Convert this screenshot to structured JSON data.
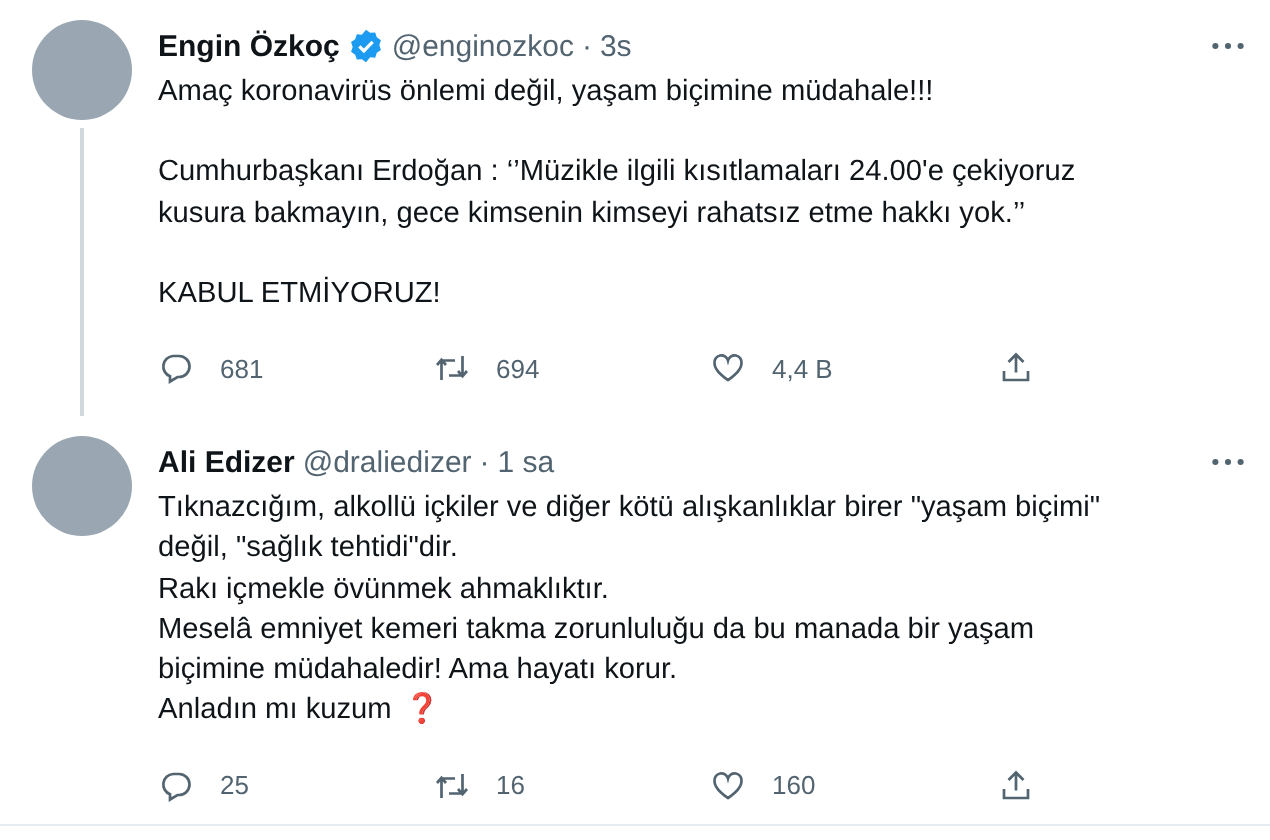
{
  "tweets": [
    {
      "name": "Engin Özkoç",
      "verified": true,
      "handle": "@enginozkoc",
      "separator": "·",
      "time": "3s",
      "thread_line": true,
      "paragraphs": [
        "Amaç koronavirüs önlemi değil, yaşam biçimine müdahale!!!",
        "Cumhurbaşkanı Erdoğan : ‘’Müzikle ilgili kısıtlamaları 24.00'e çekiyoruz kusura bakmayın, gece kimsenin kimseyi rahatsız etme hakkı yok.’’",
        "KABUL ETMİYORUZ!"
      ],
      "paragraph_gap": true,
      "replies": "681",
      "retweets": "694",
      "likes": "4,4 B"
    },
    {
      "name": "Ali Edizer",
      "verified": false,
      "handle": "@draliedizer",
      "separator": "·",
      "time": "1 sa",
      "thread_line": false,
      "paragraphs": [
        "Tıknazcığım, alkollü içkiler ve diğer kötü alışkanlıklar birer \"yaşam biçimi\" değil, \"sağlık tehtidi\"dir.",
        "Rakı içmekle övünmek ahmaklıktır.",
        "Meselâ emniyet kemeri takma zorunluluğu da bu manada bir yaşam biçimine müdahaledir! Ama hayatı korur.",
        "Anladın mı kuzum"
      ],
      "paragraph_gap": false,
      "emoji": "❓",
      "replies": "25",
      "retweets": "16",
      "likes": "160"
    }
  ]
}
